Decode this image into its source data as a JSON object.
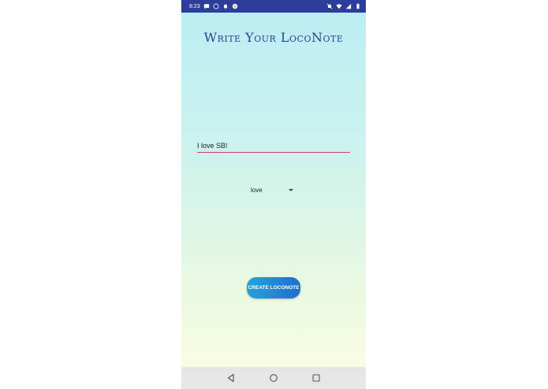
{
  "status_bar": {
    "time": "8:23",
    "left_icons": [
      "message-icon",
      "whatsapp-icon",
      "notification-bell-icon",
      "skype-icon"
    ],
    "right_icons": [
      "mute-icon",
      "wifi-icon",
      "signal-icon",
      "battery-icon"
    ]
  },
  "screen": {
    "title": "Write Your LocoNote",
    "note_input": {
      "value": "I love SB!",
      "placeholder": ""
    },
    "emotion_dropdown": {
      "selected": "love"
    },
    "create_button_label": "CREATE LOCONOTE"
  },
  "nav_bar": {
    "buttons": [
      "back-icon",
      "home-icon",
      "recents-icon"
    ]
  },
  "colors": {
    "status_bar": "#2c3e99",
    "title": "#2e3f8f",
    "input_underline": "#d43c6a",
    "button_start": "#27a1d6",
    "button_end": "#1f6fcf"
  }
}
